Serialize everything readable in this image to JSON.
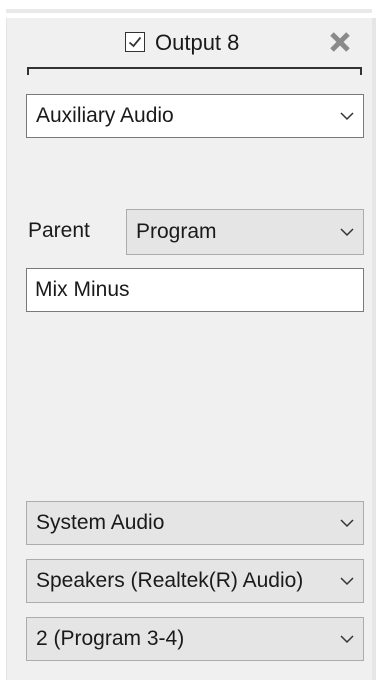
{
  "header": {
    "checked": true,
    "title": "Output 8"
  },
  "output_type": {
    "value": "Auxiliary Audio"
  },
  "parent": {
    "label": "Parent",
    "value": "Program"
  },
  "mix_name": {
    "value": "Mix Minus"
  },
  "audio_source": {
    "value": "System Audio"
  },
  "audio_device": {
    "value": "Speakers (Realtek(R) Audio)"
  },
  "channel": {
    "value": "2 (Program 3-4)"
  }
}
